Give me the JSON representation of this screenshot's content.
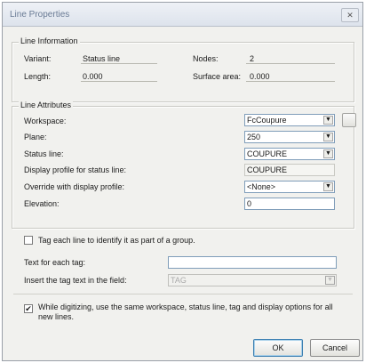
{
  "window": {
    "title": "Line Properties",
    "close_symbol": "✕"
  },
  "line_information": {
    "heading": "Line Information",
    "variant_label": "Variant:",
    "variant_value": "Status line",
    "nodes_label": "Nodes:",
    "nodes_value": "2",
    "length_label": "Length:",
    "length_value": "0.000",
    "surface_label": "Surface area:",
    "surface_value": "0.000"
  },
  "line_attributes": {
    "heading": "Line Attributes",
    "workspace_label": "Workspace:",
    "workspace_value": "FcCoupure",
    "plane_label": "Plane:",
    "plane_value": "250",
    "status_line_label": "Status line:",
    "status_line_value": "COUPURE",
    "display_profile_label": "Display profile for status line:",
    "display_profile_value": "COUPURE",
    "override_label": "Override with display profile:",
    "override_value": "<None>",
    "elevation_label": "Elevation:",
    "elevation_value": "0"
  },
  "tagging": {
    "tag_checkbox_label": "Tag each line to identify it as part of a group.",
    "tag_checked": false,
    "text_label": "Text for each tag:",
    "text_value": "",
    "insert_label": "Insert the tag text in the field:",
    "insert_value": "TAG"
  },
  "digitizing": {
    "label": "While digitizing, use the same workspace, status line, tag and display options for all new lines.",
    "checked": true,
    "check_glyph": "✔"
  },
  "buttons": {
    "ok": "OK",
    "cancel": "Cancel",
    "browse": "..."
  },
  "dropdown_glyph": "▼"
}
